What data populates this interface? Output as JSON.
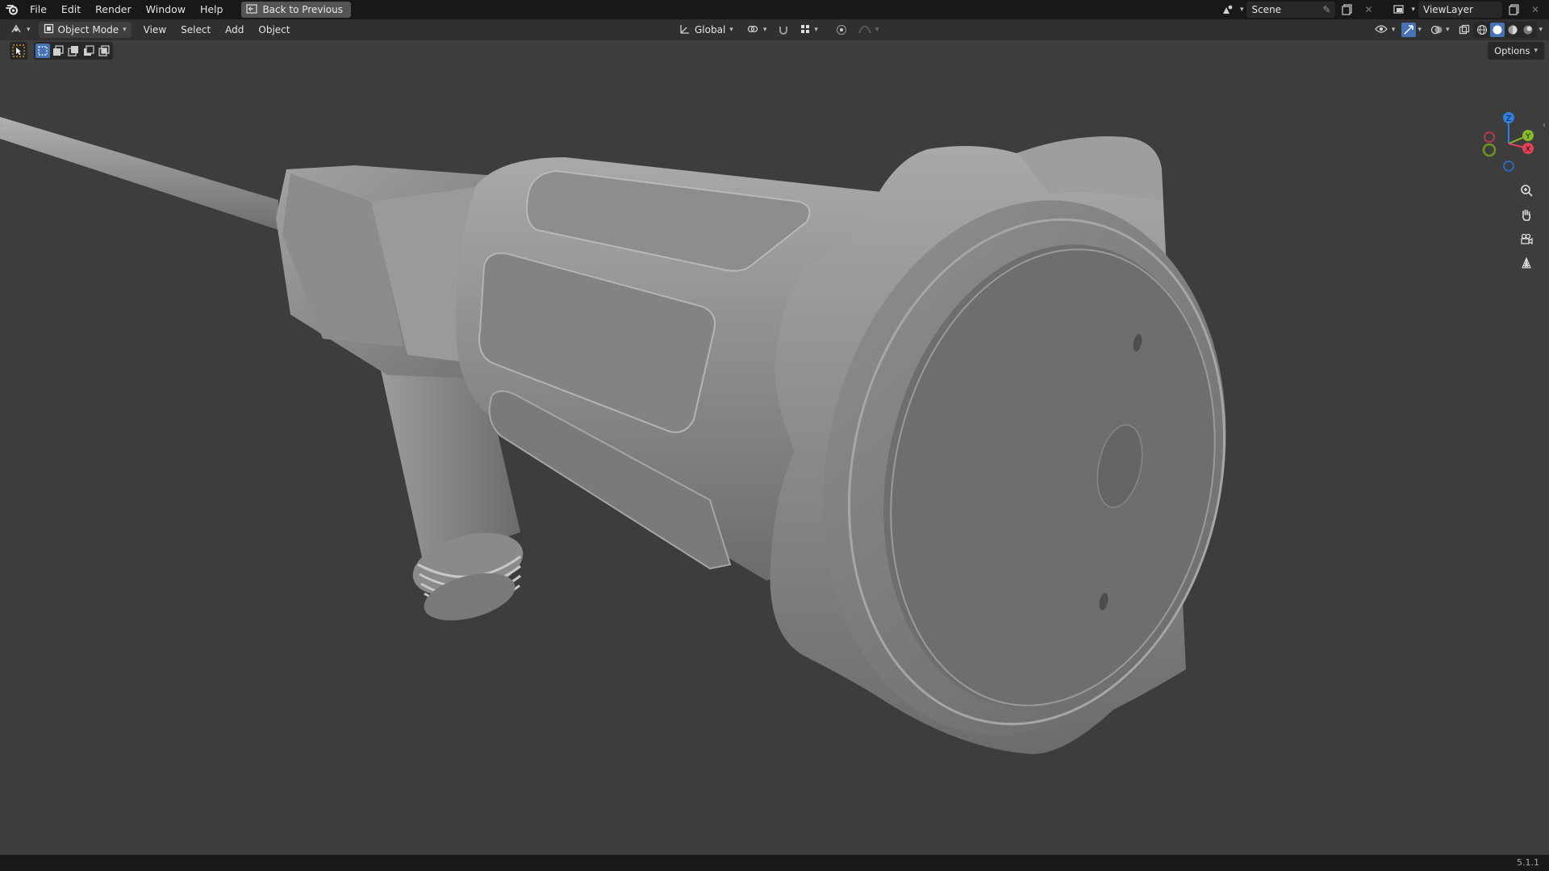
{
  "app": {
    "menu": [
      "File",
      "Edit",
      "Render",
      "Window",
      "Help"
    ],
    "back_button": "Back to Previous",
    "scene_name": "Scene",
    "view_layer": "ViewLayer",
    "version": "5.1.1"
  },
  "header": {
    "mode": "Object Mode",
    "menus": [
      "View",
      "Select",
      "Add",
      "Object"
    ],
    "transform_orientation": "Global",
    "options_label": "Options"
  },
  "gizmo": {
    "x_label": "X",
    "y_label": "Y",
    "z_label": "Z"
  },
  "icons": {
    "blender_logo": "blender-logo-icon",
    "zoom": "zoom-icon",
    "pan": "hand-icon",
    "camera": "camera-icon",
    "ortho": "grid-icon"
  },
  "colors": {
    "accent": "#4772b3",
    "axis_x": "#e14356",
    "axis_y": "#8bb92a",
    "axis_z": "#2f80e0"
  }
}
